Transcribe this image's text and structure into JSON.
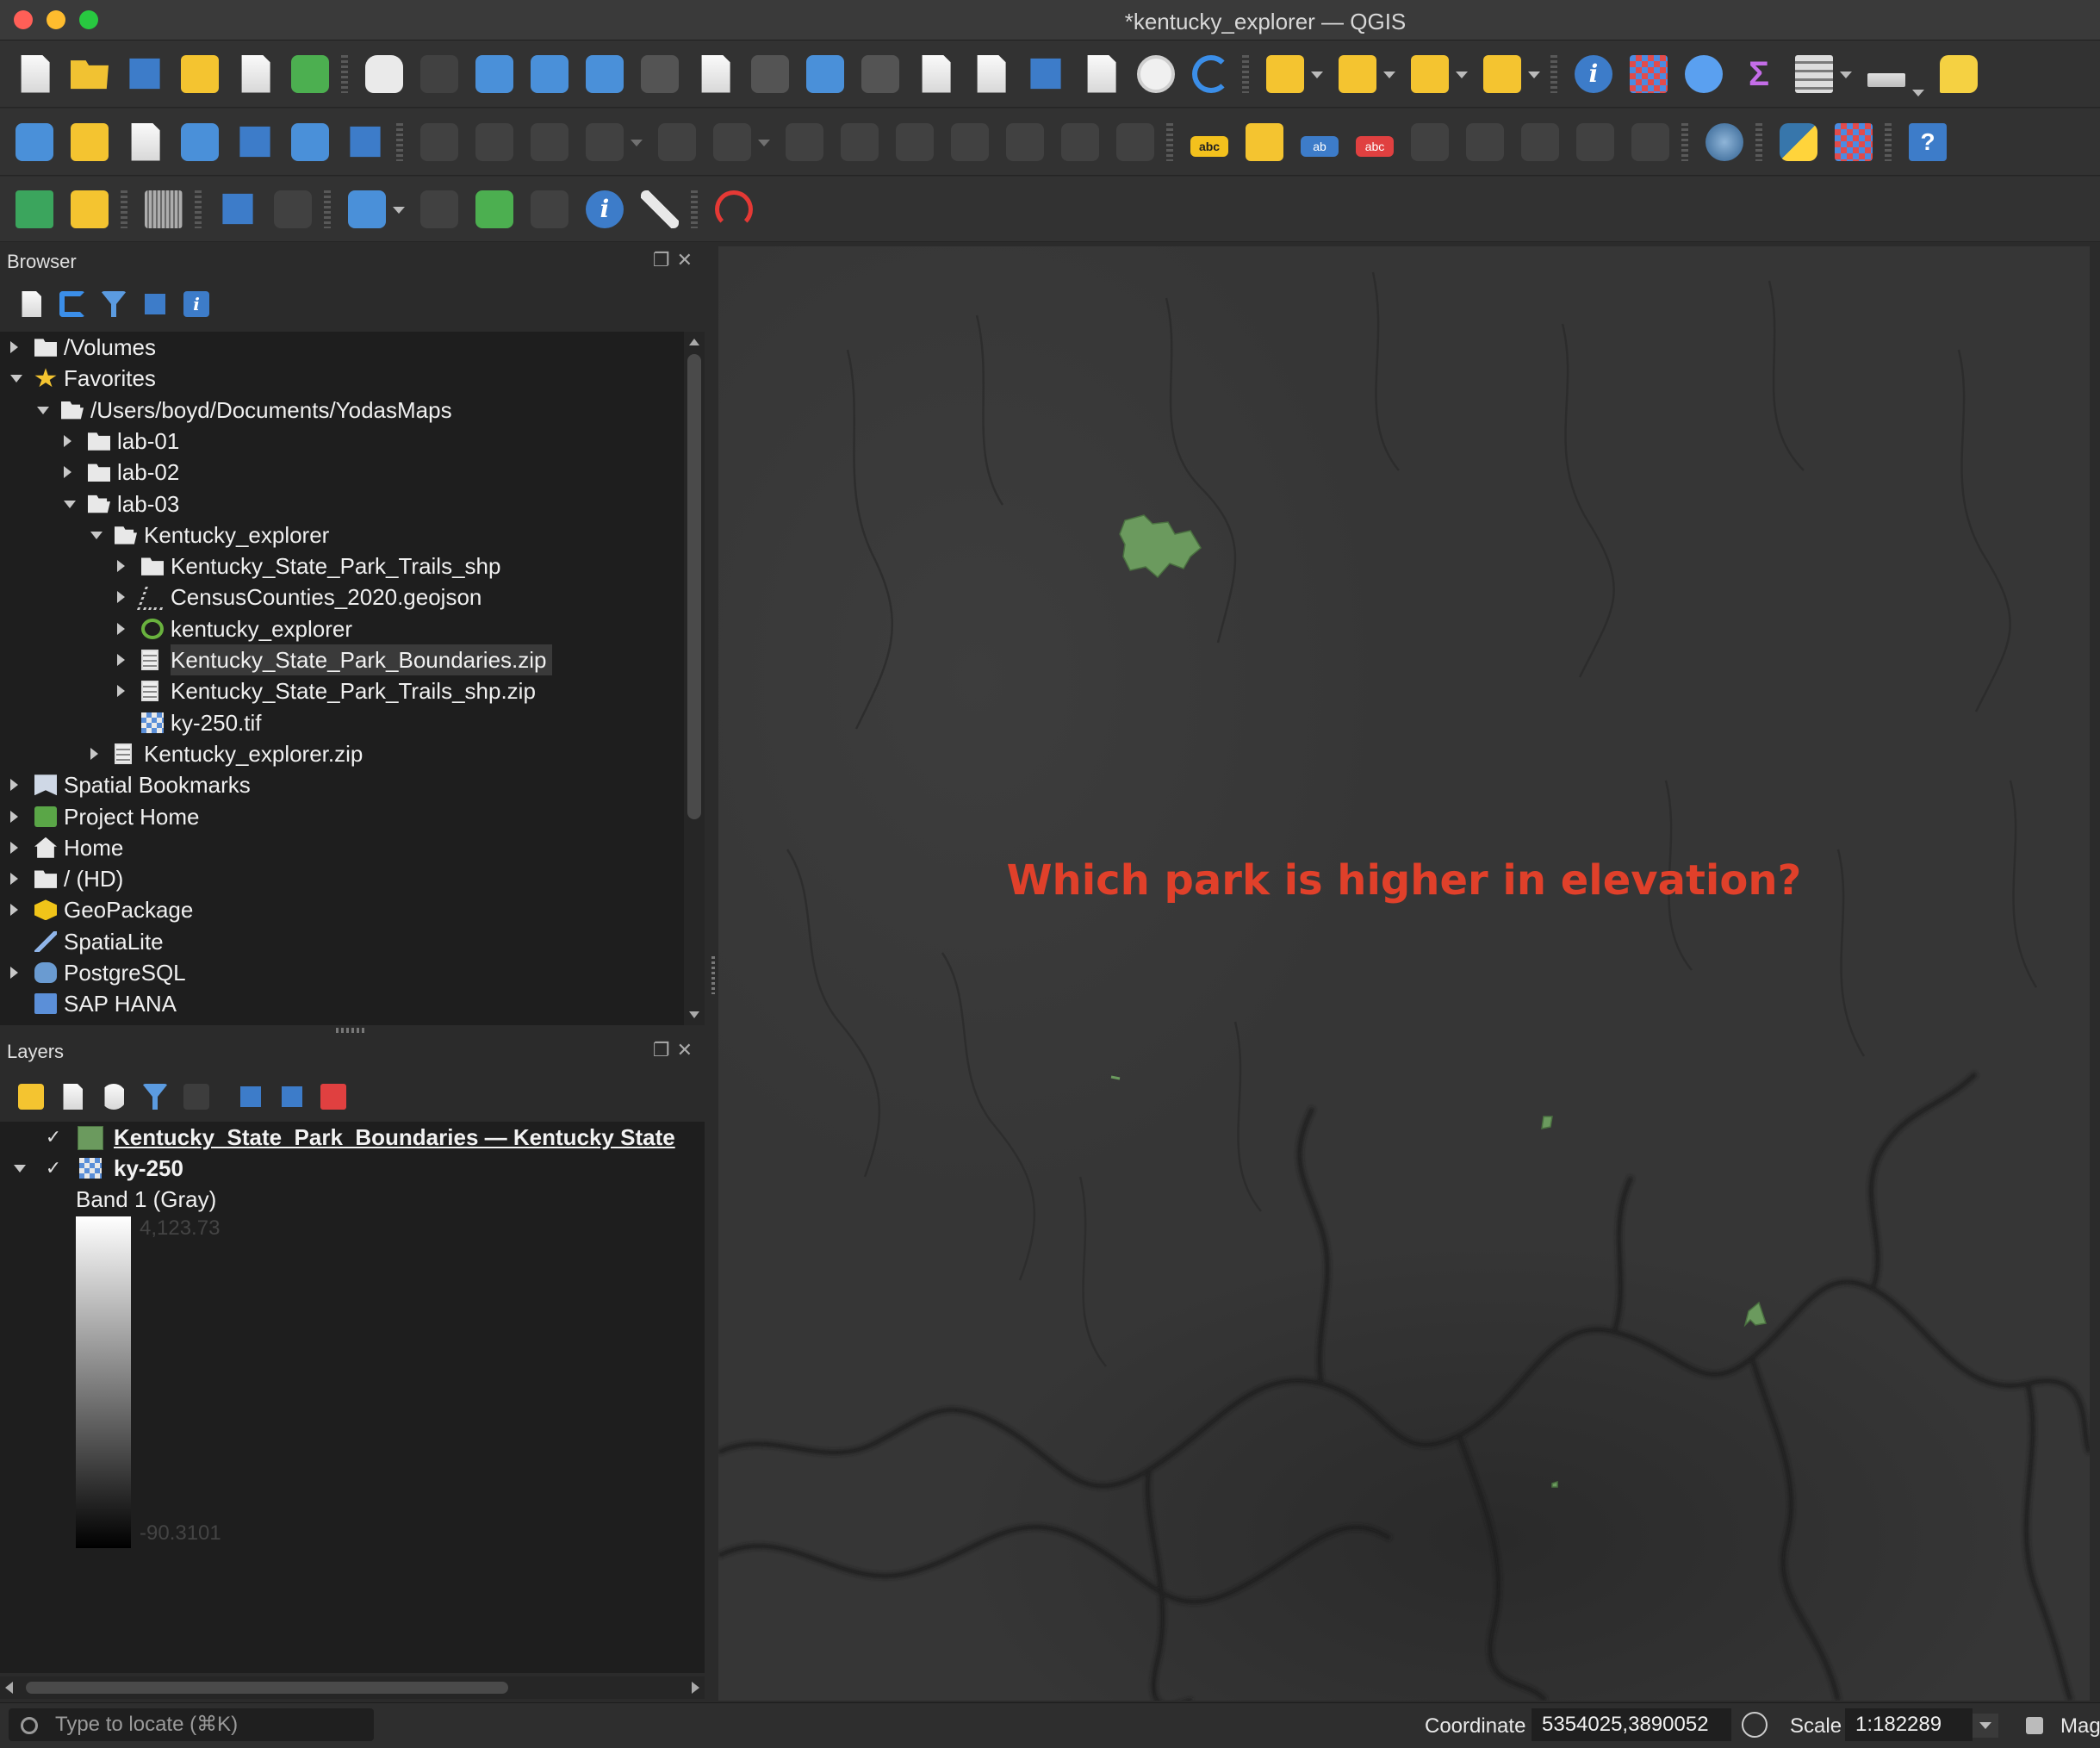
{
  "window": {
    "title": "*kentucky_explorer — QGIS"
  },
  "browser": {
    "title": "Browser",
    "items": [
      {
        "label": "/Volumes",
        "icon": "folder-icon",
        "twisty": "closed",
        "depth": 0
      },
      {
        "label": "Favorites",
        "icon": "star-icon",
        "twisty": "open",
        "depth": 0
      },
      {
        "label": "/Users/boyd/Documents/YodasMaps",
        "icon": "folder-open-icon",
        "twisty": "open",
        "depth": 1
      },
      {
        "label": "lab-01",
        "icon": "folder-icon",
        "twisty": "closed",
        "depth": 2
      },
      {
        "label": "lab-02",
        "icon": "folder-icon",
        "twisty": "closed",
        "depth": 2
      },
      {
        "label": "lab-03",
        "icon": "folder-open-icon",
        "twisty": "open",
        "depth": 2
      },
      {
        "label": "Kentucky_explorer",
        "icon": "folder-open-icon",
        "twisty": "open",
        "depth": 3
      },
      {
        "label": "Kentucky_State_Park_Trails_shp",
        "icon": "folder-icon",
        "twisty": "closed",
        "depth": 4
      },
      {
        "label": "CensusCounties_2020.geojson",
        "icon": "vector-icon",
        "twisty": "closed",
        "depth": 4
      },
      {
        "label": "kentucky_explorer",
        "icon": "qgis-project-icon",
        "twisty": "closed",
        "depth": 4
      },
      {
        "label": "Kentucky_State_Park_Boundaries.zip",
        "icon": "zip-icon",
        "twisty": "closed",
        "depth": 4,
        "selected": true
      },
      {
        "label": "Kentucky_State_Park_Trails_shp.zip",
        "icon": "zip-icon",
        "twisty": "closed",
        "depth": 4
      },
      {
        "label": "ky-250.tif",
        "icon": "raster-icon",
        "twisty": "none",
        "depth": 4
      },
      {
        "label": "Kentucky_explorer.zip",
        "icon": "zip-icon",
        "twisty": "closed",
        "depth": 3
      },
      {
        "label": "Spatial Bookmarks",
        "icon": "bookmark-icon",
        "twisty": "closed",
        "depth": 0
      },
      {
        "label": "Project Home",
        "icon": "project-home-icon",
        "twisty": "closed",
        "depth": 0
      },
      {
        "label": "Home",
        "icon": "home-icon",
        "twisty": "closed",
        "depth": 0
      },
      {
        "label": "/ (HD)",
        "icon": "folder-icon",
        "twisty": "closed",
        "depth": 0
      },
      {
        "label": "GeoPackage",
        "icon": "geopackage-icon",
        "twisty": "closed",
        "depth": 0
      },
      {
        "label": "SpatiaLite",
        "icon": "spatialite-icon",
        "twisty": "none",
        "depth": 0
      },
      {
        "label": "PostgreSQL",
        "icon": "postgresql-icon",
        "twisty": "closed",
        "depth": 0
      },
      {
        "label": "SAP HANA",
        "icon": "sap-hana-icon",
        "twisty": "none",
        "depth": 0
      }
    ]
  },
  "layers": {
    "title": "Layers",
    "items": [
      {
        "label": "Kentucky_State_Park_Boundaries — Kentucky State",
        "checked": true,
        "swatch_color": "#6b9a5e"
      },
      {
        "label": "ky-250",
        "checked": true,
        "expanded": true
      }
    ],
    "band_label": "Band 1 (Gray)",
    "ramp_max": "4,123.73",
    "ramp_min": "-90.3101"
  },
  "map": {
    "annotation": "Which park is higher in elevation?",
    "annotation_color": "#e0402a",
    "park_color": "#6b9a5e"
  },
  "status": {
    "locator_placeholder": "Type to locate (⌘K)",
    "coordinate_label": "Coordinate",
    "coordinate_value": "5354025,3890052",
    "scale_label": "Scale",
    "scale_value": "1:182289",
    "magnifier_label": "Mag"
  }
}
